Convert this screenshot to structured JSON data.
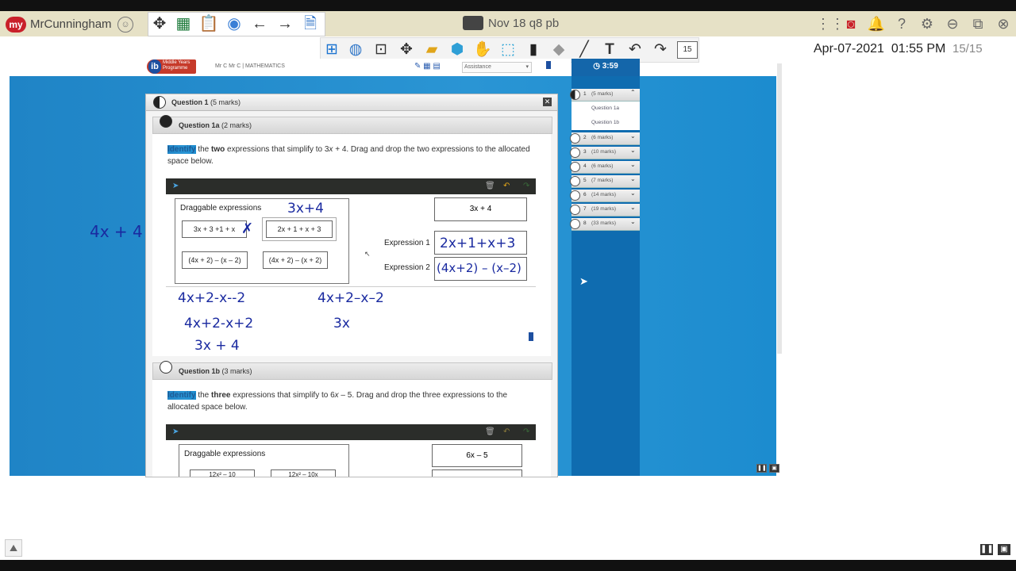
{
  "app": {
    "logo_text": "my",
    "username": "MrCunningham",
    "file_title": "Nov 18 q8 pb"
  },
  "toolbar2": {
    "page_number": "15"
  },
  "status": {
    "date": "Apr-07-2021",
    "time": "01:55 PM",
    "page_count": "15/15"
  },
  "exam": {
    "ib_logo_letter": "ib",
    "ib_logo_text": "Middle Years Programme",
    "meta": "Mr C Mr C   |   MATHEMATICS",
    "assistance": "Assistance",
    "timer": "3:59",
    "dialog_title": "Question 1",
    "dialog_marks": "(5 marks)",
    "q1a": {
      "title": "Question 1a",
      "marks": "(2 marks)",
      "identify": "Identify",
      "the": " the ",
      "two": "two",
      "text1": " expressions that simplify to 3",
      "x": "x",
      "text2": " + 4. Drag and drop the two expressions to the allocated space below.",
      "draggable_label": "Draggable expressions",
      "chips": [
        "3x + 3 +1 + x",
        "2x + 1 + x + 3",
        "(4x + 2) – (x – 2)",
        "(4x + 2) – (x + 2)"
      ],
      "target": "3x + 4",
      "expr1_label": "Expression 1",
      "expr2_label": "Expression 2"
    },
    "q1b": {
      "title": "Question 1b",
      "marks": "(3 marks)",
      "identify": "Identify",
      "the": " the ",
      "three": "three",
      "text1": " expressions that simplify to 6",
      "x": "x",
      "text2": " – 5. Drag and drop the three expressions to the allocated space below.",
      "draggable_label": "Draggable expressions",
      "chips": [
        "12x² – 10",
        "12x² – 10x"
      ],
      "target": "6x – 5"
    },
    "nav": [
      {
        "num": "1",
        "marks": "(5 marks)"
      },
      {
        "num": "2",
        "marks": "(6 marks)"
      },
      {
        "num": "3",
        "marks": "(10 marks)"
      },
      {
        "num": "4",
        "marks": "(6 marks)"
      },
      {
        "num": "5",
        "marks": "(7 marks)"
      },
      {
        "num": "6",
        "marks": "(14 marks)"
      },
      {
        "num": "7",
        "marks": "(19 marks)"
      },
      {
        "num": "8",
        "marks": "(33 marks)"
      }
    ],
    "nav_sub": [
      "Question 1a",
      "Question 1b"
    ]
  },
  "handwriting": {
    "left_margin": "4x + 4",
    "above_chip": "3x+4",
    "cross": "✗",
    "expr1_answer": "2x+1+x+3",
    "expr2_answer": "(4x+2) – (x–2)",
    "work1": "4x+2-x--2",
    "work2": "4x+2-x+2",
    "work3": "3x + 4",
    "work4": "4x+2–x–2",
    "work5": "3x"
  }
}
